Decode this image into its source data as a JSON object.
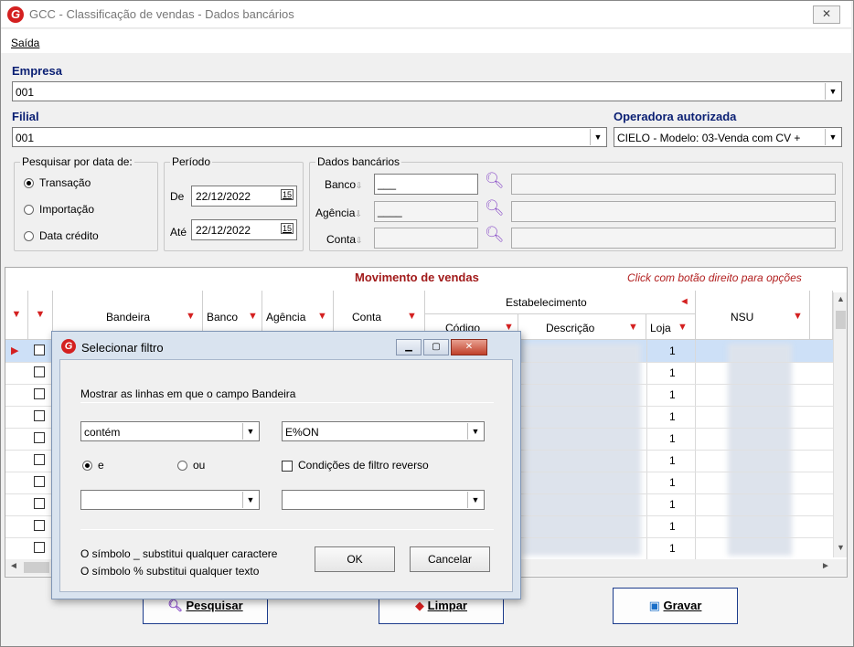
{
  "window": {
    "title": "GCC - Classificação de vendas - Dados bancários",
    "close_glyph": "✕",
    "logo_letter": "G"
  },
  "menu": {
    "saida": "Saída"
  },
  "empresa": {
    "label": "Empresa",
    "value": "001"
  },
  "filial": {
    "label": "Filial",
    "value": "001"
  },
  "operadora": {
    "label": "Operadora autorizada",
    "value": "CIELO - Modelo: 03-Venda com CV +"
  },
  "pesquisar": {
    "title": "Pesquisar por data de:",
    "options": [
      "Transação",
      "Importação",
      "Data crédito"
    ],
    "selected": "Transação"
  },
  "periodo": {
    "title": "Período",
    "de_label": "De",
    "de_value": "22/12/2022",
    "ate_label": "Até",
    "ate_value": "22/12/2022",
    "cal_glyph": "15"
  },
  "dados_bancarios": {
    "title": "Dados bancários",
    "banco_label": "Banco",
    "banco_value": "___",
    "agencia_label": "Agência",
    "agencia_value": "____",
    "conta_label": "Conta"
  },
  "grid": {
    "title": "Movimento de vendas",
    "hint": "Click com botão direito para opções",
    "headers": {
      "bandeira": "Bandeira",
      "banco": "Banco",
      "agencia": "Agência",
      "conta": "Conta",
      "estabelecimento": "Estabelecimento",
      "codigo": "Código",
      "descricao": "Descrição",
      "loja": "Loja",
      "nsu": "NSU"
    },
    "loja_values": [
      "1",
      "1",
      "1",
      "1",
      "1",
      "1",
      "1",
      "1",
      "1",
      "1"
    ]
  },
  "buttons": {
    "pesquisar": "Pesquisar",
    "limpar": "Limpar",
    "gravar": "Gravar"
  },
  "dialog": {
    "title": "Selecionar filtro",
    "prompt": "Mostrar as linhas em que o campo Bandeira",
    "operator": "contém",
    "value": "E%ON",
    "and_label": "e",
    "or_label": "ou",
    "reverse_label": "Condições de filtro reverso",
    "hint1": "O símbolo _ substitui qualquer caractere",
    "hint2": "O símbolo % substitui qualquer texto",
    "ok": "OK",
    "cancel": "Cancelar",
    "min_glyph": "▁",
    "max_glyph": "▢",
    "close_glyph": "✕"
  }
}
